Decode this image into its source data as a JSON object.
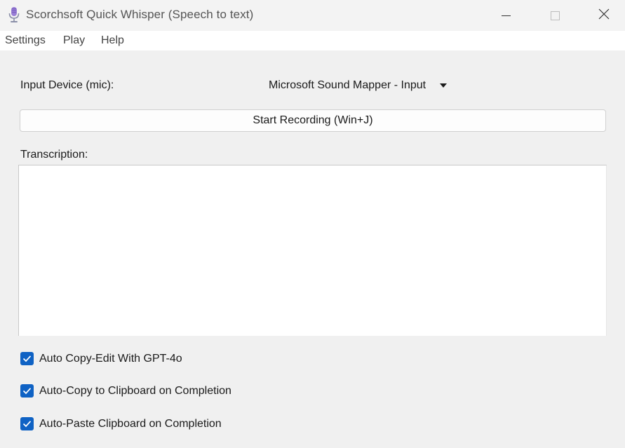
{
  "window": {
    "title": "Scorchsoft Quick Whisper (Speech to text)",
    "icon": "microphone-icon",
    "controls": [
      "minimize-icon",
      "maximize-icon",
      "close-icon"
    ]
  },
  "menu": {
    "items": [
      "Settings",
      "Play",
      "Help"
    ]
  },
  "input_device": {
    "label": "Input Device (mic):",
    "selected": "Microsoft Sound Mapper - Input"
  },
  "record_button": {
    "label": "Start Recording (Win+J)"
  },
  "transcription": {
    "label": "Transcription:",
    "value": ""
  },
  "options": [
    {
      "label": "Auto Copy-Edit With GPT-4o",
      "checked": true
    },
    {
      "label": "Auto-Copy to Clipboard on Completion",
      "checked": true
    },
    {
      "label": "Auto-Paste Clipboard on Completion",
      "checked": true
    }
  ],
  "colors": {
    "checkbox": "#0f62c4",
    "background": "#f0f0f0",
    "titlebar": "#f3f3f3"
  }
}
